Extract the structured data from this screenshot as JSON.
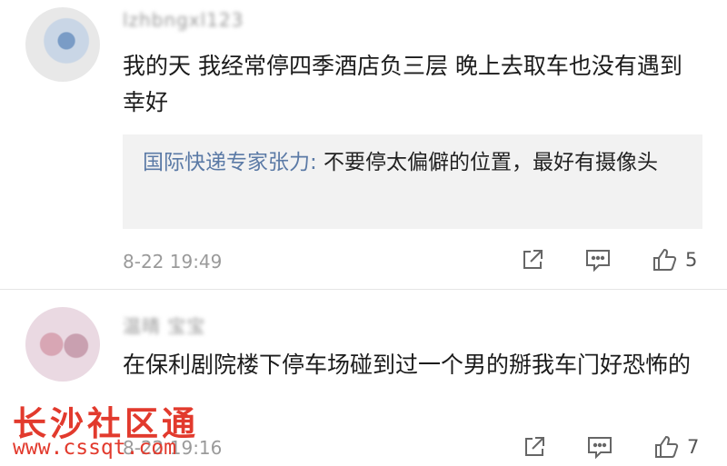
{
  "comments": [
    {
      "username": "lzhbngxl123",
      "text": "我的天 我经常停四季酒店负三层 晚上去取车也没有遇到 幸好",
      "reply": {
        "author": "国际快递专家张力:",
        "text": " 不要停太偏僻的位置，最好有摄像头"
      },
      "timestamp": "8-22 19:49",
      "like_count": "5"
    },
    {
      "username": "温晴 宝宝",
      "text": "在保利剧院楼下停车场碰到过一个男的掰我车门好恐怖的",
      "timestamp": "8-22 19:16",
      "like_count": "7"
    }
  ],
  "icons": [
    "share-icon",
    "comment-icon",
    "like-icon"
  ],
  "watermark": {
    "title": "长沙社区通",
    "url": "www.cssqt.com",
    "color": "#e23a2d"
  },
  "colors": {
    "reply_author": "#5b7aa6",
    "reply_bg": "#f2f2f2"
  }
}
